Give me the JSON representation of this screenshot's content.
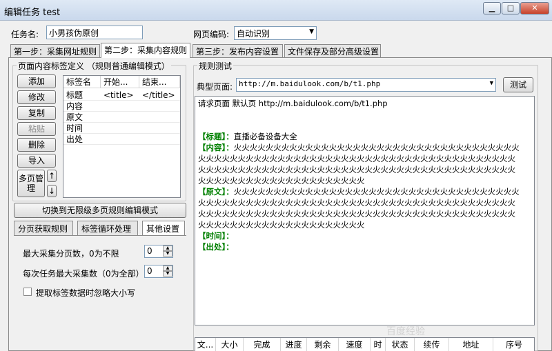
{
  "window": {
    "title": "编辑任务 test",
    "min_label": "▁",
    "max_label": "□",
    "close_label": "✕"
  },
  "task": {
    "name_label": "任务名:",
    "name_value": "小男孩伪原创",
    "encoding_label": "网页编码:",
    "encoding_value": "自动识别"
  },
  "tabs": [
    "第一步：采集网址规则",
    "第二步：采集内容规则",
    "第三步：发布内容设置",
    "文件保存及部分高级设置"
  ],
  "tag_group": {
    "legend": "页面内容标签定义 （规则普通编辑模式）",
    "buttons": {
      "add": "添加",
      "edit": "修改",
      "copy": "复制",
      "paste": "粘贴",
      "delete": "删除",
      "import": "导入",
      "multipage": "多页管理",
      "up": "↑",
      "down": "↓"
    },
    "columns": [
      "标签名",
      "开始...",
      "结束..."
    ],
    "rows": [
      {
        "name": "标题",
        "start": "<title>",
        "end": "</title>"
      },
      {
        "name": "内容",
        "start": "",
        "end": ""
      },
      {
        "name": "原文",
        "start": "",
        "end": ""
      },
      {
        "name": "时间",
        "start": "",
        "end": ""
      },
      {
        "name": "出处",
        "start": "",
        "end": ""
      }
    ]
  },
  "switch_button": "切换到无限级多页规则编辑模式",
  "subtabs": [
    "分页获取规则",
    "标签循环处理",
    "其他设置"
  ],
  "other_settings": {
    "max_pages_label": "最大采集分页数，0为不限",
    "max_pages_value": "0",
    "max_items_label": "每次任务最大采集数（0为全部）:",
    "max_items_value": "0",
    "ignore_case_label": "提取标签数据时忽略大小写"
  },
  "rule_test": {
    "legend": "规则测试",
    "typical_page_label": "典型页面:",
    "typical_page_value": "http://m.baidulook.com/b/t1.php",
    "test_button": "测试",
    "request_line": "请求页面 默认页 http://m.baidulook.com/b/t1.php",
    "fields": {
      "title_label": "【标题】：",
      "title_value": "直播必备设备大全",
      "content_label": "【内容】：",
      "content_line1": "火火火火火火火火火火火火火火火火火火火火火火火火火火火火火火火火火火火火",
      "content_line2": "火火火火火火火火火火火火火火火火火火火火火火火火火火火火火火火火火火火火火火火火",
      "content_line3": "火火火火火火火火火火火火火火火火火火火火火火火火火火火火火火火火火火火火火火火火",
      "content_line4": "火火火火火火火火火火火火火火火火火火火火火",
      "original_label": "【原文】：",
      "original_line1": "火火火火火火火火火火火火火火火火火火火火火火火火火火火火火火火火火火火火",
      "original_line2": "火火火火火火火火火火火火火火火火火火火火火火火火火火火火火火火火火火火火火火火火",
      "original_line3": "火火火火火火火火火火火火火火火火火火火火火火火火火火火火火火火火火火火火火火火火",
      "original_line4": "火火火火火火火火火火火火火火火火火火火火火",
      "time_label": "【时间】：",
      "source_label": "【出处】："
    }
  },
  "download_columns": [
    "文...",
    "大小",
    "完成",
    "进度",
    "剩余",
    "速度",
    "时",
    "状态",
    "续传",
    "地址",
    "序号"
  ],
  "watermark": "百度经验"
}
